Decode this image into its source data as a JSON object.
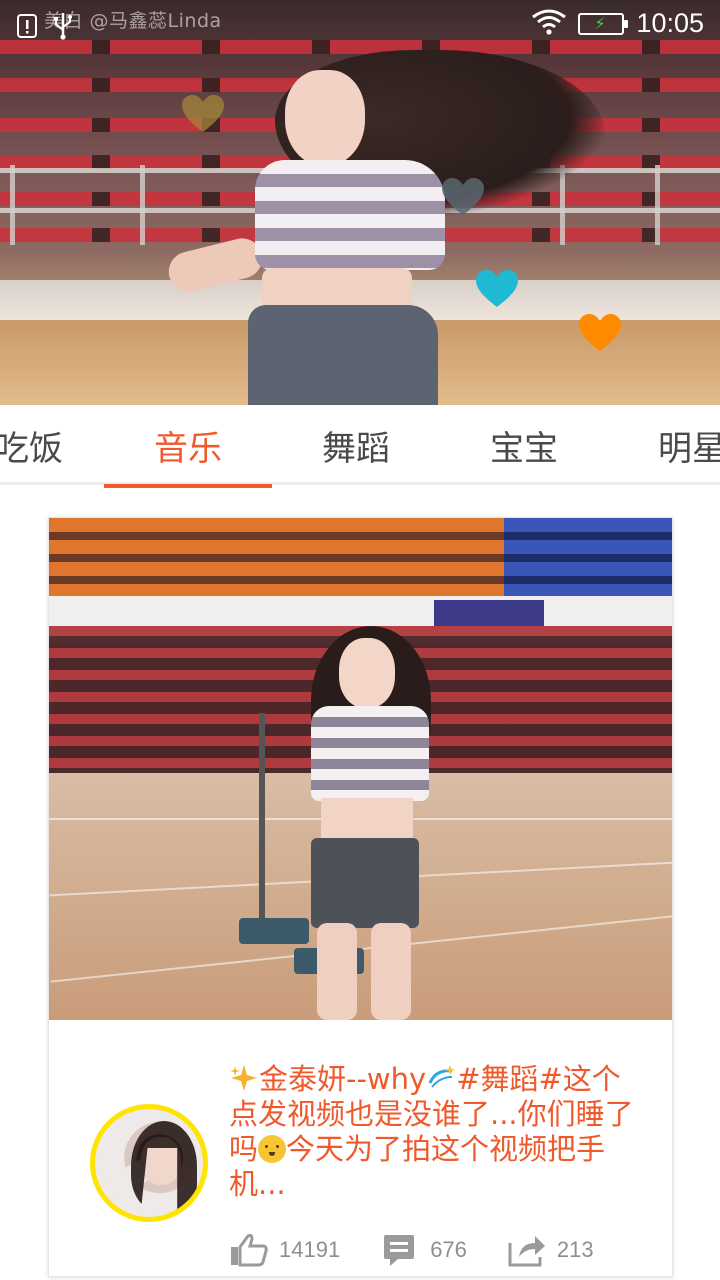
{
  "status_bar": {
    "time": "10:05",
    "icons": [
      "notification-icon",
      "usb-icon",
      "wifi-icon",
      "battery-charging-icon"
    ]
  },
  "hero": {
    "watermark": "美白 @马鑫蕊Linda",
    "hearts": [
      {
        "color": "#a88a3a"
      },
      {
        "color": "#5b6670"
      },
      {
        "color": "#1fb9d4"
      },
      {
        "color": "#ff8a00"
      }
    ]
  },
  "tabs": [
    {
      "label": "吃饭",
      "active": false
    },
    {
      "label": "音乐",
      "active": true
    },
    {
      "label": "舞蹈",
      "active": false
    },
    {
      "label": "宝宝",
      "active": false
    },
    {
      "label": "明星",
      "active": false
    }
  ],
  "colors": {
    "accent": "#f0592b",
    "avatar_ring": "#ffe400"
  },
  "card": {
    "description": {
      "part1": "金泰妍--why",
      "part2": "#舞蹈#这个点发视频也是没谁了...你们睡了吗",
      "part3": "今天为了拍这个视频把手机..."
    },
    "stats": {
      "likes": "14191",
      "comments": "676",
      "shares": "213"
    }
  }
}
